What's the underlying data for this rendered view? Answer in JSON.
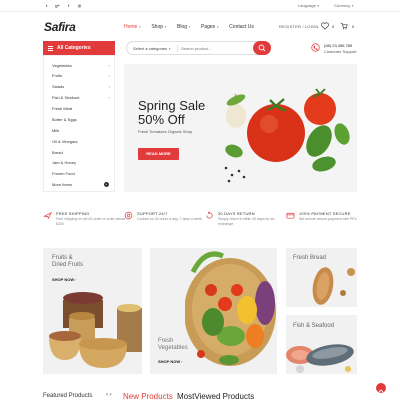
{
  "topbar": {
    "social": [
      {
        "icon": "twitter-icon",
        "glyph": "t"
      },
      {
        "icon": "google-plus-icon",
        "glyph": "g+"
      },
      {
        "icon": "facebook-icon",
        "glyph": "f"
      },
      {
        "icon": "instagram-icon",
        "glyph": "◎"
      }
    ],
    "language": "Language",
    "currency": "Currency"
  },
  "header": {
    "logo": "Safira",
    "nav": [
      {
        "label": "Home",
        "active": true
      },
      {
        "label": "Shop",
        "active": false
      },
      {
        "label": "Blog",
        "active": false
      },
      {
        "label": "Pages",
        "active": false
      },
      {
        "label": "Contact Us",
        "active": false
      }
    ],
    "account": "REGISTER / LOGIN",
    "wishlist_count": "0",
    "cart_count": "0"
  },
  "search": {
    "all_categories": "All Categories",
    "category_select": "Select a categories",
    "placeholder": "Search product..."
  },
  "support": {
    "phone": "(08) 23 456 789",
    "label": "Customer Support"
  },
  "sidebar": {
    "items": [
      {
        "label": "Vegetables",
        "has_sub": true
      },
      {
        "label": "Fruits",
        "has_sub": true
      },
      {
        "label": "Salads",
        "has_sub": true
      },
      {
        "label": "Fish & Seafood",
        "has_sub": true
      },
      {
        "label": "Fresh Meat",
        "has_sub": false
      },
      {
        "label": "Butter & Eggs",
        "has_sub": false
      },
      {
        "label": "Milk",
        "has_sub": false
      },
      {
        "label": "Oil & Vinegars",
        "has_sub": false
      },
      {
        "label": "Bread",
        "has_sub": false
      },
      {
        "label": "Jam & Honey",
        "has_sub": false
      },
      {
        "label": "Frozen Food",
        "has_sub": false
      },
      {
        "label": "More Items",
        "has_sub": false
      }
    ]
  },
  "hero": {
    "title_line1": "Spring Sale",
    "title_line2": "50% Off",
    "subtitle": "Fresh Tomatoes Organic Shop",
    "button": "READ MORE"
  },
  "features": [
    {
      "title": "FREE SHIPPING",
      "desc": "Free shipping on all US order or order above $200"
    },
    {
      "title": "SUPPORT 24/7",
      "desc": "Contact us 24 hours a day, 7 days a week"
    },
    {
      "title": "30 DAYS RETURN",
      "desc": "Simply return it within 30 days for an exchange"
    },
    {
      "title": "100% PAYMENT SECURE",
      "desc": "We ensure secure payment with PEV"
    }
  ],
  "banners": {
    "fruits_line1": "Fruits &",
    "fruits_line2": "Dried Fruits",
    "fruits_link": "SHOP NOW",
    "veg_line1": "Fresh",
    "veg_line2": "Vegetables",
    "veg_link": "SHOP NOW",
    "bread": "Fresh Bread",
    "fish": "Fish & Seafood"
  },
  "tabs": {
    "featured": "Featured Products",
    "arrows": "‹  ›",
    "new": "New Products",
    "most": "MostViewed Products"
  },
  "colors": {
    "accent": "#e23b3b",
    "background": "#ffffff",
    "panel": "#f2f2f2"
  }
}
